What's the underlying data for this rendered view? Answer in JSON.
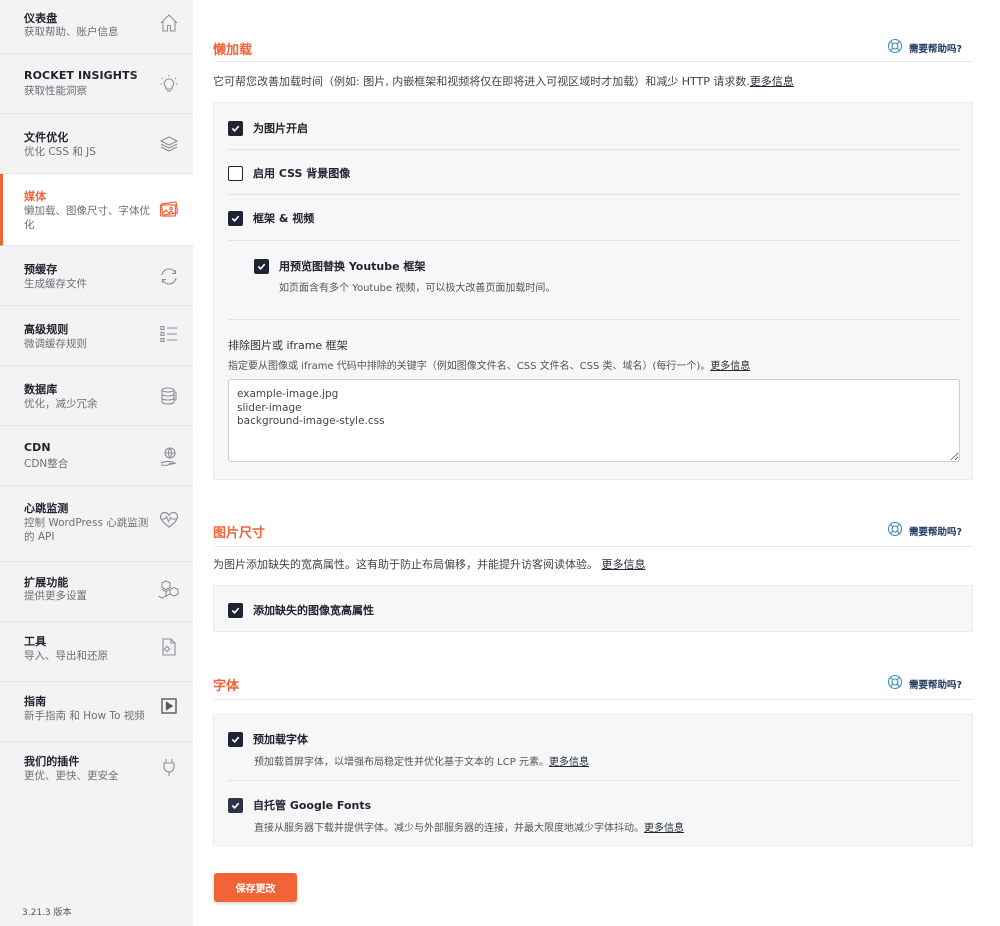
{
  "sidebar": {
    "items": [
      {
        "title": "仪表盘",
        "sub": "获取帮助、账户信息",
        "icon": "home-icon"
      },
      {
        "title": "ROCKET INSIGHTS",
        "sub": "获取性能洞察",
        "icon": "lightbulb-icon"
      },
      {
        "title": "文件优化",
        "sub": "优化 CSS 和 JS",
        "icon": "layers-icon"
      },
      {
        "title": "媒体",
        "sub": "懒加载、图像尺寸、字体优化",
        "icon": "image-icon"
      },
      {
        "title": "预缓存",
        "sub": "生成缓存文件",
        "icon": "refresh-icon"
      },
      {
        "title": "高级规则",
        "sub": "微调缓存规则",
        "icon": "list-icon"
      },
      {
        "title": "数据库",
        "sub": "优化，减少冗余",
        "icon": "database-icon"
      },
      {
        "title": "CDN",
        "sub": "CDN整合",
        "icon": "globe-hand-icon"
      },
      {
        "title": "心跳监测",
        "sub": "控制 WordPress 心跳监测的 API",
        "icon": "heartbeat-icon"
      },
      {
        "title": "扩展功能",
        "sub": "提供更多设置",
        "icon": "cubes-icon"
      },
      {
        "title": "工具",
        "sub": "导入、导出和还原",
        "icon": "file-gear-icon"
      },
      {
        "title": "指南",
        "sub": "新手指南 和 How To 视频",
        "icon": "play-icon"
      },
      {
        "title": "我们的插件",
        "sub": "更优、更快、更安全",
        "icon": "plug-icon"
      }
    ],
    "version": "3.21.3 版本"
  },
  "help_label": "需要帮助吗?",
  "lazyload": {
    "title": "懒加载",
    "desc": "它可帮您改善加载时间（例如: 图片, 内嵌框架和视频将仅在即将进入可视区域时才加载）和减少 HTTP 请求数.",
    "more": "更多信息",
    "images_label": "为图片开启",
    "css_bg_label": "启用 CSS 背景图像",
    "iframes_label": "框架 & 视频",
    "youtube_label": "用预览图替换 Youtube 框架",
    "youtube_desc": "如页面含有多个 Youtube 视频，可以极大改善页面加载时间。",
    "exclude_label": "排除图片或 iframe 框架",
    "exclude_desc": "指定要从图像或 iframe 代码中排除的关键字（例如图像文件名、CSS 文件名、CSS 类、域名）(每行一个)。",
    "exclude_more": "更多信息",
    "exclude_value": "example-image.jpg\nslider-image\nbackground-image-style.css"
  },
  "image_dims": {
    "title": "图片尺寸",
    "desc": "为图片添加缺失的宽高属性。这有助于防止布局偏移，并能提升访客阅读体验。",
    "more": "更多信息",
    "add_label": "添加缺失的图像宽高属性"
  },
  "fonts": {
    "title": "字体",
    "preload_label": "预加载字体",
    "preload_desc": "预加载首屏字体，以增强布局稳定性并优化基于文本的 LCP 元素。",
    "preload_more": "更多信息",
    "google_label": "自托管 Google Fonts",
    "google_desc": "直接从服务器下载并提供字体。减少与外部服务器的连接，并最大限度地减少字体抖动。",
    "google_more": "更多信息"
  },
  "save_label": "保存更改",
  "colors": {
    "accent": "#f26437",
    "checkbox": "#1f2335"
  }
}
